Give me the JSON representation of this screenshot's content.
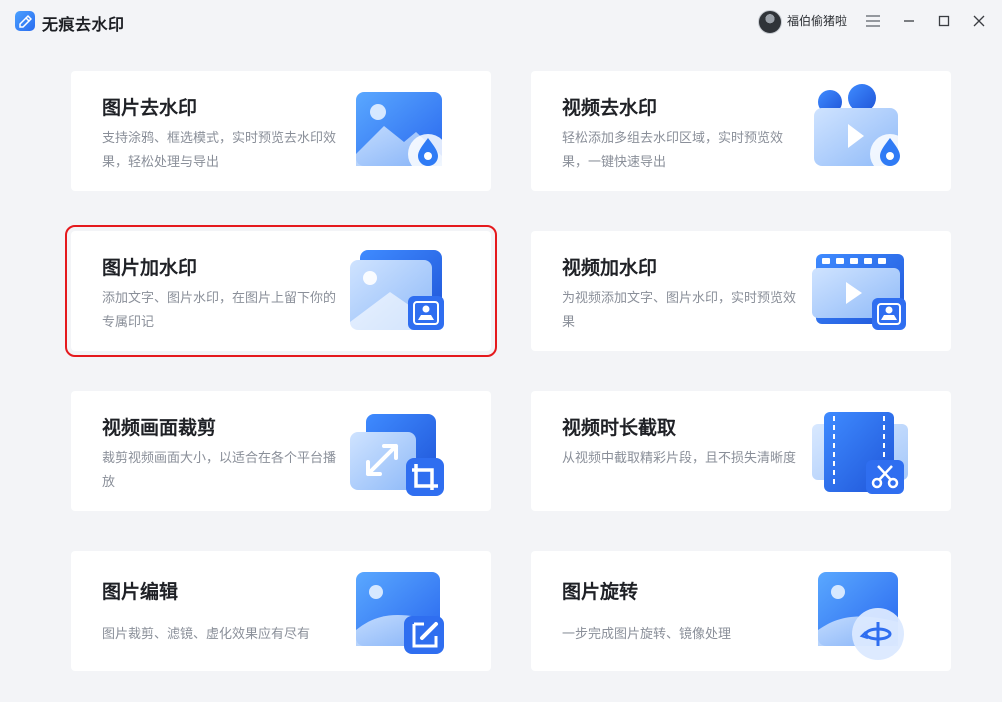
{
  "app": {
    "title": "无痕去水印",
    "username": "福伯偷猪啦"
  },
  "window": {
    "menu_icon": "hamburger-icon",
    "minimize_icon": "minimize-icon",
    "maximize_icon": "maximize-icon",
    "close_icon": "close-icon"
  },
  "colors": {
    "accent": "#2f7bf5",
    "card_bg": "#ffffff",
    "page_bg": "#f3f4f7",
    "selection": "#e5191d"
  },
  "cards": [
    {
      "title": "图片去水印",
      "desc": "支持涂鸦、框选模式，实时预览去水印效果，轻松处理与导出",
      "icon": "image-droplet-icon"
    },
    {
      "title": "视频去水印",
      "desc": "轻松添加多组去水印区域，实时预览效果，一键快速导出",
      "icon": "video-droplet-icon"
    },
    {
      "title": "图片加水印",
      "desc": "添加文字、图片水印，在图片上留下你的专属印记",
      "icon": "image-stamp-icon",
      "selected": true
    },
    {
      "title": "视频加水印",
      "desc": "为视频添加文字、图片水印，实时预览效果",
      "icon": "video-stamp-icon"
    },
    {
      "title": "视频画面裁剪",
      "desc": "裁剪视频画面大小，以适合在各个平台播放",
      "icon": "crop-icon"
    },
    {
      "title": "视频时长截取",
      "desc": "从视频中截取精彩片段，且不损失清晰度",
      "icon": "film-scissors-icon"
    },
    {
      "title": "图片编辑",
      "desc": "图片裁剪、滤镜、虚化效果应有尽有",
      "icon": "image-edit-icon"
    },
    {
      "title": "图片旋转",
      "desc": "一步完成图片旋转、镜像处理",
      "icon": "image-rotate-icon"
    }
  ]
}
